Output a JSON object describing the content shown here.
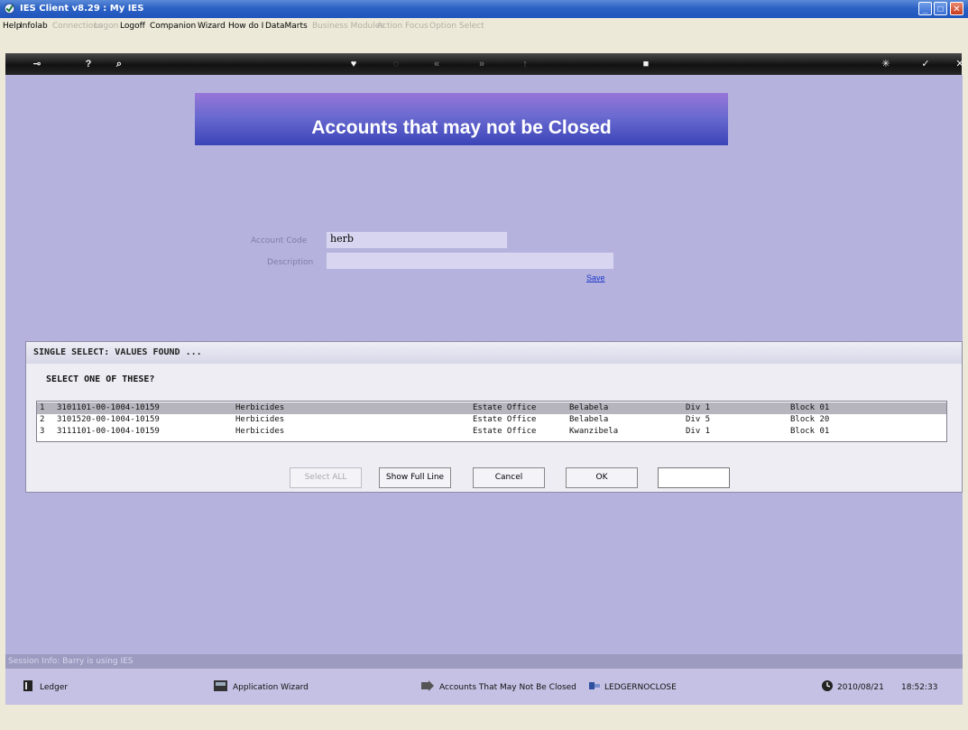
{
  "window": {
    "title": "IES Client v8.29 : My IES"
  },
  "menu": [
    {
      "label": "Help",
      "enabled": true
    },
    {
      "label": "Infolab",
      "enabled": true
    },
    {
      "label": "Connections",
      "enabled": false
    },
    {
      "label": "Logon",
      "enabled": false
    },
    {
      "label": "Logoff",
      "enabled": true
    },
    {
      "label": "Companion",
      "enabled": true
    },
    {
      "label": "Wizard",
      "enabled": true
    },
    {
      "label": "How do I",
      "enabled": true
    },
    {
      "label": "DataMarts",
      "enabled": true
    },
    {
      "label": "Business Modules",
      "enabled": false
    },
    {
      "label": "Action Focus",
      "enabled": false
    },
    {
      "label": "Option Select",
      "enabled": false
    }
  ],
  "toolbar": {
    "icons": [
      "key-icon",
      "help-icon",
      "search-icon",
      "heart-icon",
      "power-icon",
      "rewind-icon",
      "fast-forward-icon",
      "pin-icon",
      "stop-icon",
      "refresh-icon",
      "check-icon",
      "close-icon"
    ]
  },
  "form": {
    "banner": "Accounts that may not be Closed",
    "account_code_label": "Account Code",
    "account_code_value": "herb",
    "description_label": "Description",
    "description_value": "",
    "save_label": "Save"
  },
  "dialog": {
    "header": "SINGLE SELECT: VALUES FOUND ...",
    "prompt": "SELECT ONE OF THESE?",
    "rows": [
      {
        "num": "1",
        "code": "3101101-00-1004-10159",
        "desc": "Herbicides",
        "office": "Estate Office",
        "location": "Belabela",
        "div": "Div 1",
        "block": "Block 01"
      },
      {
        "num": "2",
        "code": "3101520-00-1004-10159",
        "desc": "Herbicides",
        "office": "Estate Office",
        "location": "Belabela",
        "div": "Div 5",
        "block": "Block 20"
      },
      {
        "num": "3",
        "code": "3111101-00-1004-10159",
        "desc": "Herbicides",
        "office": "Estate Office",
        "location": "Kwanzibela",
        "div": "Div 1",
        "block": "Block 01"
      }
    ],
    "buttons": {
      "select_all": "Select ALL",
      "show_full_line": "Show Full Line",
      "cancel": "Cancel",
      "ok": "OK"
    }
  },
  "session": "Session Info: Barry is using IES",
  "status": {
    "module": "Ledger",
    "wizard": "Application Wizard",
    "screen": "Accounts That May Not Be Closed",
    "code": "LEDGERNOCLOSE",
    "date": "2010/08/21",
    "time": "18:52:33"
  },
  "colors": {
    "accent_blue": "#2c62c4",
    "workspace": "#b5b3de",
    "banner_start": "#9876d8",
    "banner_end": "#3b44b8"
  }
}
